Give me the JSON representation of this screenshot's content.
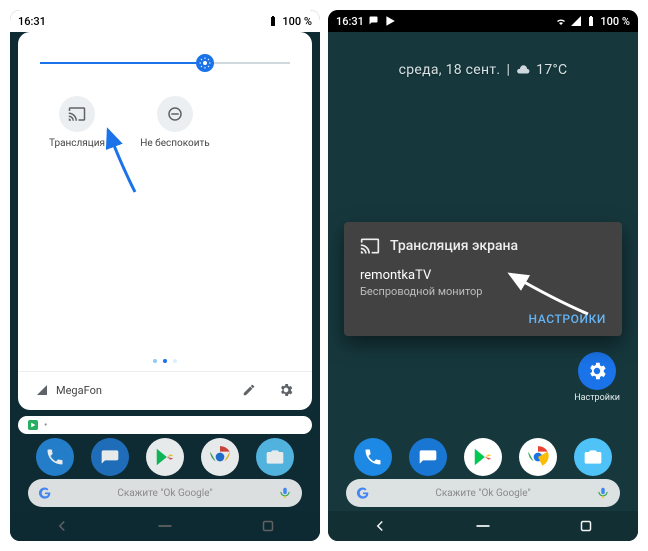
{
  "left": {
    "status": {
      "time": "16:31",
      "battery": "100 %"
    },
    "qs": {
      "tiles": [
        {
          "label": "Трансляция"
        },
        {
          "label": "Не беспокоить"
        }
      ],
      "footer_carrier": "MegaFon"
    },
    "search_hint": "Скажите \"Ok Google\""
  },
  "right": {
    "status": {
      "time": "16:31",
      "battery": "100 %"
    },
    "date": "среда, 18 сент.",
    "temp": "17°C",
    "settings_label": "Настройки",
    "cast": {
      "title": "Трансляция экрана",
      "device": "remontkaTV",
      "device_sub": "Беспроводной монитор",
      "action": "НАСТРОЙКИ"
    },
    "search_hint": "Скажите \"Ok Google\""
  }
}
